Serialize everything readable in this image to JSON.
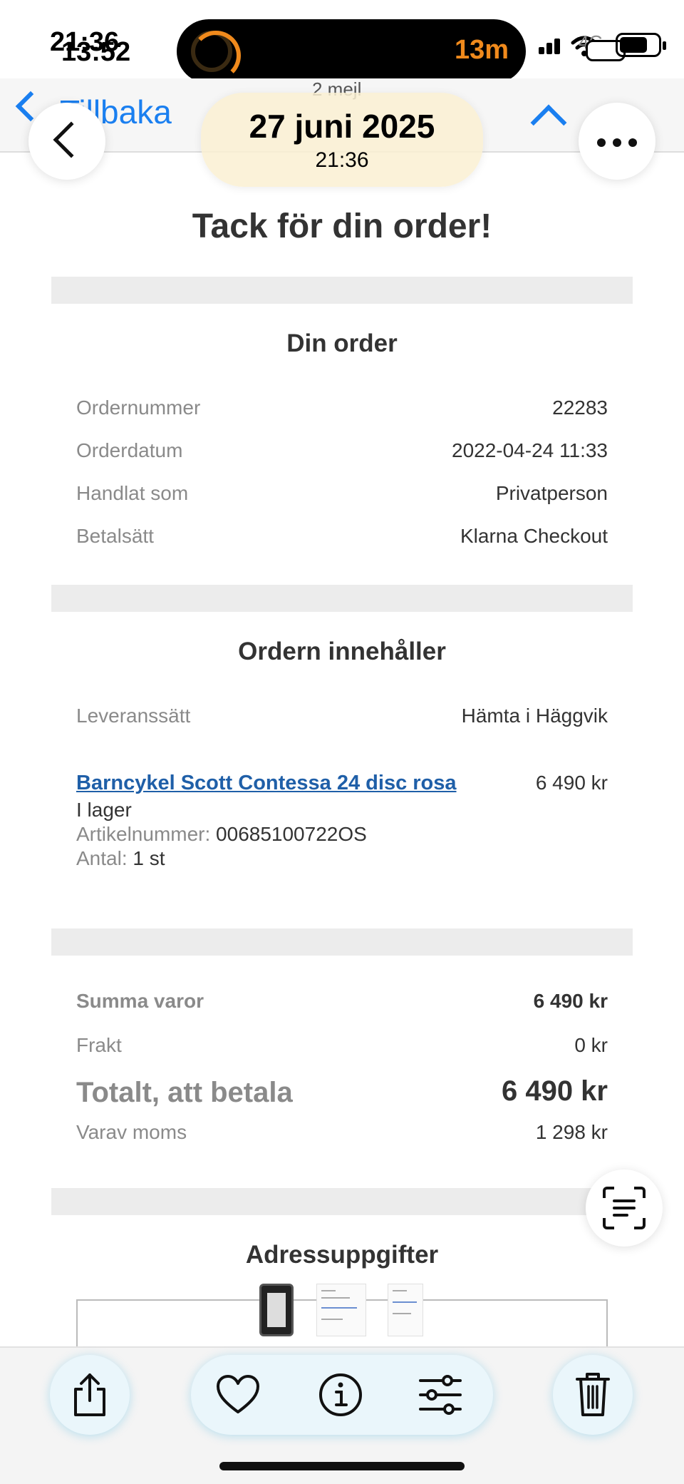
{
  "status_bar": {
    "time_primary": "21:36",
    "time_secondary": "13:52",
    "island_timer": "13m",
    "network": "4G",
    "accent_color": "#f08a1c"
  },
  "mail_nav": {
    "back_label": "Tillbaka",
    "message_count": "2 mejl",
    "accent_color": "#1a7ff0"
  },
  "photo_overlay": {
    "date": "27 juni 2025",
    "time": "21:36"
  },
  "email": {
    "heading": "Tack för din order!",
    "order_section": {
      "title": "Din order",
      "rows": [
        {
          "label": "Ordernummer",
          "value": "22283"
        },
        {
          "label": "Orderdatum",
          "value": "2022-04-24 11:33"
        },
        {
          "label": "Handlat som",
          "value": "Privatperson"
        },
        {
          "label": "Betalsätt",
          "value": "Klarna Checkout"
        }
      ]
    },
    "contents_section": {
      "title": "Ordern innehåller",
      "delivery_label": "Leveranssätt",
      "delivery_value": "Hämta i Häggvik",
      "product": {
        "name": "Barncykel Scott Contessa 24 disc rosa",
        "price": "6 490 kr",
        "stock": "I lager",
        "article_label": "Artikelnummer:",
        "article_value": "00685100722OS",
        "quantity_label": "Antal:",
        "quantity_value": "1 st"
      }
    },
    "summary": {
      "goods_label": "Summa varor",
      "goods_value": "6 490 kr",
      "shipping_label": "Frakt",
      "shipping_value": "0 kr",
      "total_label": "Totalt, att betala",
      "total_value": "6 490 kr",
      "vat_label": "Varav moms",
      "vat_value": "1 298 kr"
    },
    "address_section": {
      "title": "Adressuppgifter"
    }
  },
  "toolbar": {
    "icons": [
      "share-icon",
      "heart-icon",
      "info-icon",
      "adjust-icon",
      "trash-icon"
    ]
  }
}
